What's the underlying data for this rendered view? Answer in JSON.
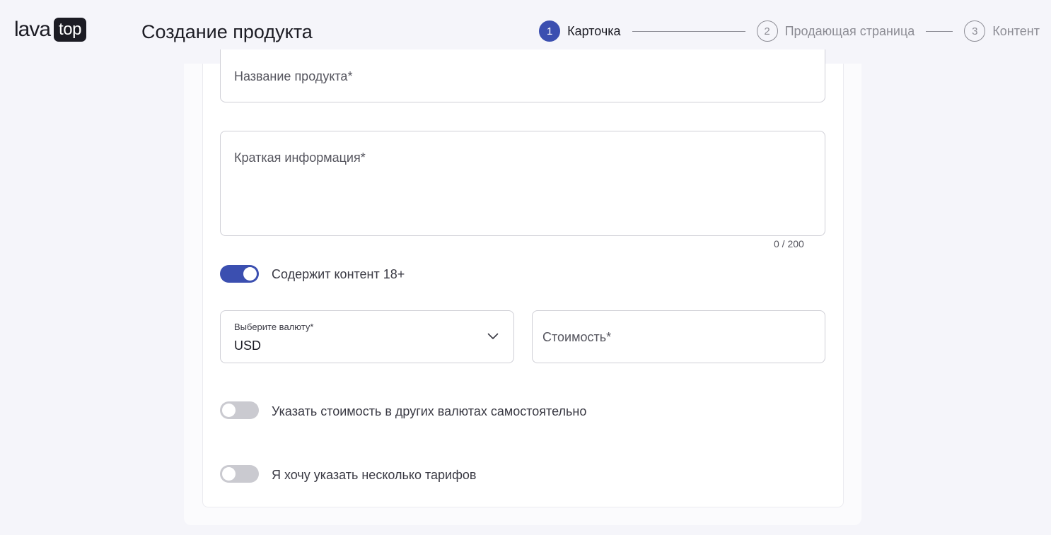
{
  "logo": {
    "part1": "lava",
    "part2": "top"
  },
  "page_title": "Создание продукта",
  "stepper": [
    {
      "num": "1",
      "label": "Карточка"
    },
    {
      "num": "2",
      "label": "Продающая страница"
    },
    {
      "num": "3",
      "label": "Контент"
    }
  ],
  "form": {
    "product_name_placeholder": "Название продукта*",
    "short_info_placeholder": "Краткая информация*",
    "short_info_counter": "0 / 200",
    "adult_toggle": {
      "label": "Содержит контент 18+",
      "checked": true
    },
    "currency": {
      "label": "Выберите валюту*",
      "value": "USD"
    },
    "price_placeholder": "Стоимость*",
    "other_currencies_toggle": {
      "label": "Указать стоимость в других валютах самостоятельно",
      "checked": false
    },
    "tariffs_toggle": {
      "label": "Я хочу указать несколько тарифов",
      "checked": false
    }
  },
  "colors": {
    "accent": "#3b4fb0",
    "toggle_off": "#cacad0"
  }
}
